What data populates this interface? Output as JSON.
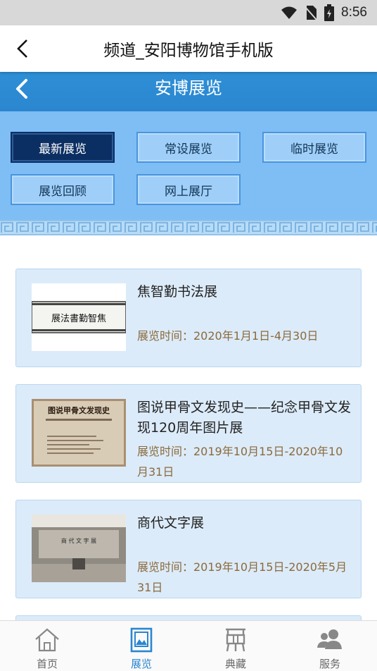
{
  "status_bar": {
    "time": "8:56"
  },
  "app_bar": {
    "title": "频道_安阳博物馆手机版"
  },
  "section_header": {
    "title": "安博展览"
  },
  "categories": [
    {
      "label": "最新展览",
      "active": true
    },
    {
      "label": "常设展览",
      "active": false
    },
    {
      "label": "临时展览",
      "active": false
    },
    {
      "label": "展览回顾",
      "active": false
    },
    {
      "label": "网上展厅",
      "active": false
    }
  ],
  "exhibitions": [
    {
      "name": "焦智勤书法展",
      "date": "展览时间：2020年1月1日-4月30日",
      "thumb_text": "展法書勤智焦"
    },
    {
      "name": "图说甲骨文发现史——纪念甲骨文发现120周年图片展",
      "date": "展览时间：2019年10月15日-2020年10月31日",
      "thumb_text": "图说甲骨文发现史"
    },
    {
      "name": "商代文字展",
      "date": "展览时间：2019年10月15日-2020年5月31日",
      "thumb_text": "商 代 文 字 展"
    }
  ],
  "tabs": [
    {
      "label": "首页",
      "icon": "home-icon",
      "active": false
    },
    {
      "label": "展览",
      "icon": "frame-icon",
      "active": true
    },
    {
      "label": "典藏",
      "icon": "bronze-vessel-icon",
      "active": false
    },
    {
      "label": "服务",
      "icon": "users-icon",
      "active": false
    }
  ],
  "colors": {
    "primary": "#2b86cf",
    "active_category": "#0c2f63",
    "panel": "#7fbdf5",
    "date_text": "#8a6a3c"
  }
}
